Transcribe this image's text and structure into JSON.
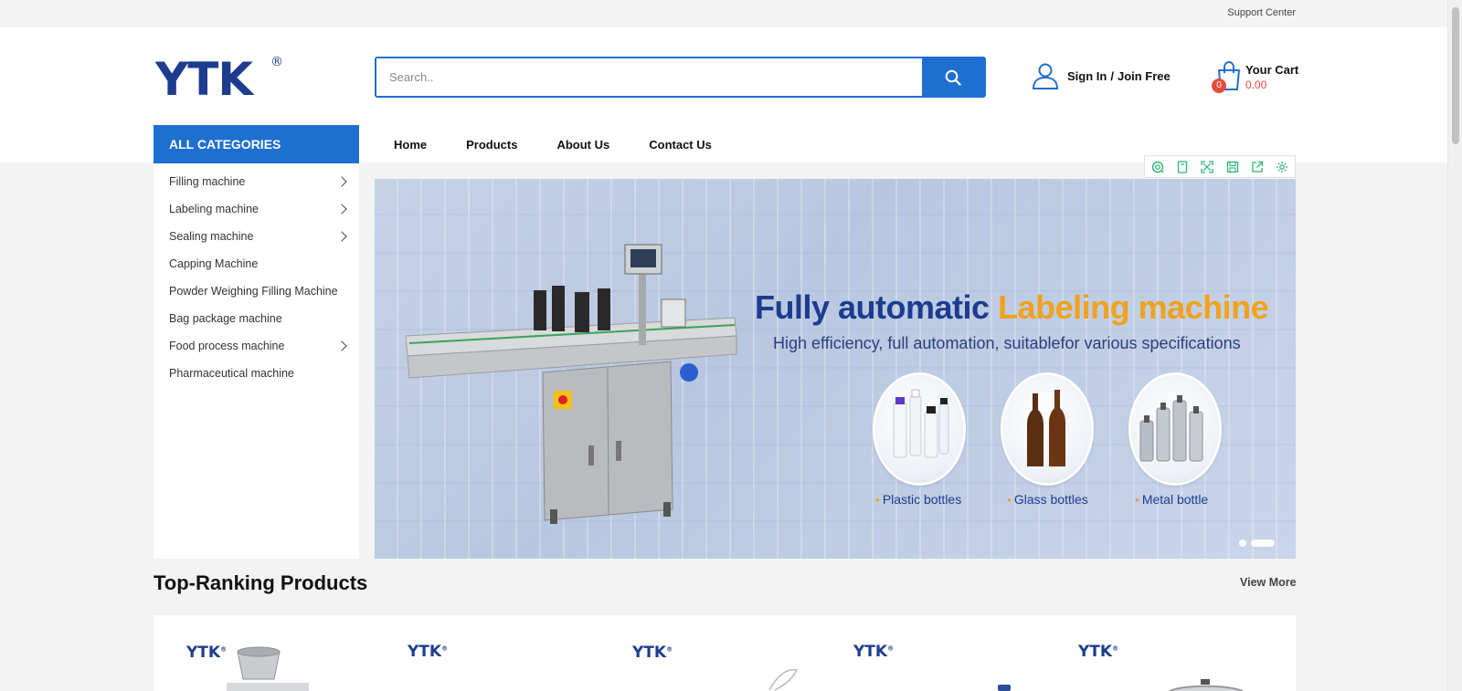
{
  "topbar": {
    "support_label": "Support Center"
  },
  "logo": {
    "text": "YTK",
    "mark": "®"
  },
  "search": {
    "placeholder": "Search..",
    "value": ""
  },
  "account": {
    "sign_in": "Sign In",
    "separator": "/",
    "join": "Join Free"
  },
  "cart": {
    "count": "0",
    "title": "Your Cart",
    "total": "0.00"
  },
  "categories": {
    "heading": "ALL CATEGORIES",
    "items": [
      {
        "label": "Filling machine",
        "has_sub": true
      },
      {
        "label": "Labeling machine",
        "has_sub": true
      },
      {
        "label": "Sealing machine",
        "has_sub": true
      },
      {
        "label": "Capping Machine",
        "has_sub": false
      },
      {
        "label": "Powder Weighing Filling Machine",
        "has_sub": false
      },
      {
        "label": "Bag package machine",
        "has_sub": false
      },
      {
        "label": "Food process machine",
        "has_sub": true
      },
      {
        "label": "Pharmaceutical machine",
        "has_sub": false
      }
    ]
  },
  "nav": {
    "items": [
      "Home",
      "Products",
      "About Us",
      "Contact Us"
    ]
  },
  "toolbar": {
    "icons": [
      "lens-icon",
      "bookmark-icon",
      "fullscreen-icon",
      "save-icon",
      "share-icon",
      "settings-icon"
    ]
  },
  "banner": {
    "title_part1": "Fully automatic",
    "title_part2": "Labeling machine",
    "subtitle": "High efficiency, full automation, suitablefor various specifications",
    "bottles": [
      "Plastic bottles",
      "Glass bottles",
      "Metal bottle"
    ],
    "slides": 2,
    "active_slide": 2
  },
  "section": {
    "title": "Top-Ranking Products",
    "view_more": "View More"
  },
  "products": {
    "logos": [
      "YTK",
      "YTK",
      "YTK",
      "YTK",
      "YTK"
    ]
  },
  "colors": {
    "brand_blue": "#1f6fd0",
    "navy": "#1d3c8f",
    "accent_orange": "#f0a21c",
    "badge_red": "#e74c3c"
  }
}
